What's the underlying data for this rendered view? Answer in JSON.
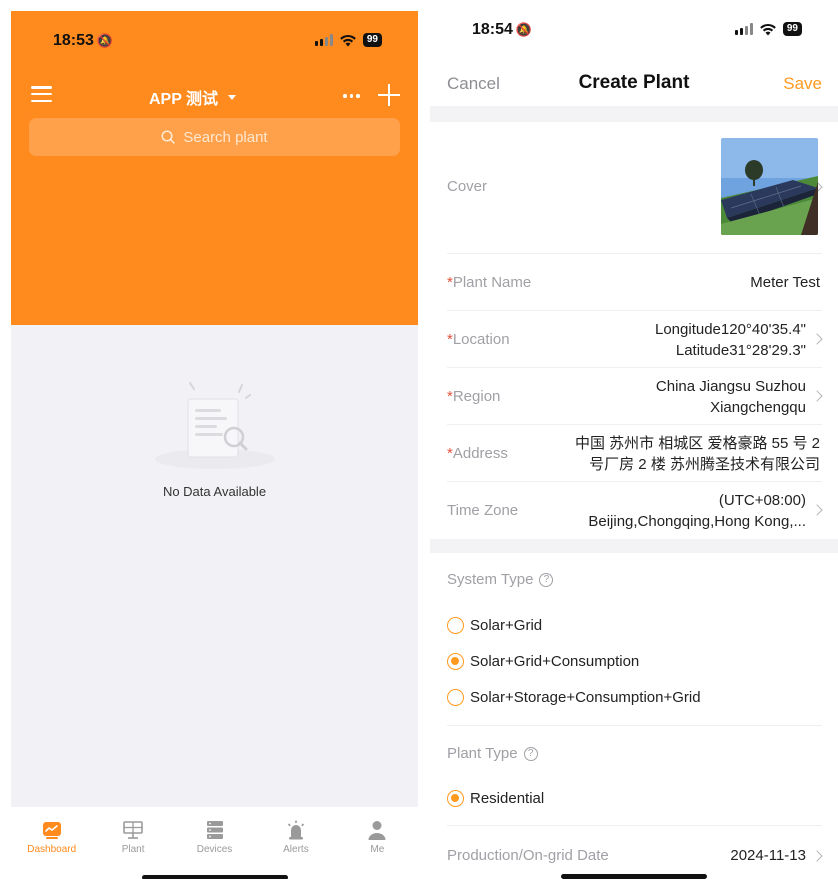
{
  "left": {
    "status": {
      "time": "18:53",
      "battery": "99"
    },
    "header": {
      "title": "APP 测试"
    },
    "search": {
      "placeholder": "Search plant"
    },
    "empty": {
      "text": "No Data Available"
    },
    "tabs": [
      {
        "label": "Dashboard",
        "icon": "dashboard-icon",
        "active": true
      },
      {
        "label": "Plant",
        "icon": "plant-icon",
        "active": false
      },
      {
        "label": "Devices",
        "icon": "devices-icon",
        "active": false
      },
      {
        "label": "Alerts",
        "icon": "alerts-icon",
        "active": false
      },
      {
        "label": "Me",
        "icon": "me-icon",
        "active": false
      }
    ],
    "colors": {
      "accent": "#ff8a1d",
      "background": "#f2f2f6"
    }
  },
  "right": {
    "status": {
      "time": "18:54",
      "battery": "99"
    },
    "nav": {
      "cancel": "Cancel",
      "title": "Create Plant",
      "save": "Save"
    },
    "form": {
      "cover_label": "Cover",
      "plant_name": {
        "label": "Plant Name",
        "value": "Meter Test"
      },
      "location": {
        "label": "Location",
        "line1": "Longitude120°40'35.4\"",
        "line2": "Latitude31°28'29.3\""
      },
      "region": {
        "label": "Region",
        "line1": "China Jiangsu Suzhou",
        "line2": "Xiangchengqu"
      },
      "address": {
        "label": "Address",
        "line1": "中国 苏州市 相城区 爱格豪路 55 号 2",
        "line2": "号厂房 2 楼 苏州腾圣技术有限公司"
      },
      "time_zone": {
        "label": "Time Zone",
        "line1": "(UTC+08:00)",
        "line2": "Beijing,Chongqing,Hong Kong,..."
      },
      "system_type": {
        "label": "System Type",
        "options": [
          {
            "label": "Solar+Grid",
            "checked": false
          },
          {
            "label": "Solar+Grid+Consumption",
            "checked": true
          },
          {
            "label": "Solar+Storage+Consumption+Grid",
            "checked": false
          }
        ]
      },
      "plant_type": {
        "label": "Plant Type",
        "options": [
          {
            "label": "Residential",
            "checked": true
          }
        ]
      },
      "production_date": {
        "label": "Production/On-grid Date",
        "value": "2024-11-13"
      }
    },
    "colors": {
      "accent": "#ff9a1f",
      "required": "#e0523d"
    }
  }
}
